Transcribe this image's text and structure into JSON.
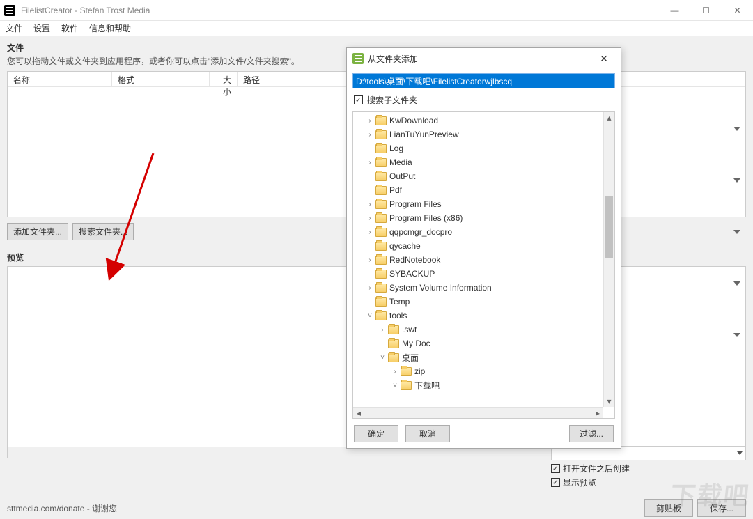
{
  "title": "FilelistCreator - Stefan Trost Media",
  "menu": {
    "file": "文件",
    "settings": "设置",
    "software": "软件",
    "help": "信息和帮助"
  },
  "files_panel": {
    "heading": "文件",
    "hint": "您可以拖动文件或文件夹到应用程序，或者你可以点击\"添加文件/文件夹搜索\"。",
    "cols": {
      "name": "名称",
      "format": "格式",
      "size": "大小",
      "path": "路径"
    },
    "btn_add": "添加文件夹...",
    "btn_search": "搜索文件夹..."
  },
  "preview": {
    "heading": "预览"
  },
  "bottom": {
    "chk_open_after": "打开文件之后创建",
    "chk_show_preview": "显示预览",
    "btn_clipboard": "剪贴板",
    "btn_save": "保存..."
  },
  "status": "sttmedia.com/donate - 谢谢您",
  "dialog": {
    "title": "从文件夹添加",
    "path": "D:\\tools\\桌面\\下载吧\\FilelistCreatorwjlbscq",
    "chk_sub": "搜索子文件夹",
    "btn_ok": "确定",
    "btn_cancel": "取消",
    "btn_filter": "过滤...",
    "tree": [
      {
        "depth": 0,
        "exp": ">",
        "label": "KwDownload"
      },
      {
        "depth": 0,
        "exp": ">",
        "label": "LianTuYunPreview"
      },
      {
        "depth": 0,
        "exp": "",
        "label": "Log"
      },
      {
        "depth": 0,
        "exp": ">",
        "label": "Media"
      },
      {
        "depth": 0,
        "exp": "",
        "label": "OutPut"
      },
      {
        "depth": 0,
        "exp": "",
        "label": "Pdf"
      },
      {
        "depth": 0,
        "exp": ">",
        "label": "Program Files"
      },
      {
        "depth": 0,
        "exp": ">",
        "label": "Program Files (x86)"
      },
      {
        "depth": 0,
        "exp": ">",
        "label": "qqpcmgr_docpro"
      },
      {
        "depth": 0,
        "exp": "",
        "label": "qycache"
      },
      {
        "depth": 0,
        "exp": ">",
        "label": "RedNotebook"
      },
      {
        "depth": 0,
        "exp": "",
        "label": "SYBACKUP"
      },
      {
        "depth": 0,
        "exp": ">",
        "label": "System Volume Information"
      },
      {
        "depth": 0,
        "exp": "",
        "label": "Temp"
      },
      {
        "depth": 0,
        "exp": "v",
        "label": "tools"
      },
      {
        "depth": 1,
        "exp": ">",
        "label": ".swt"
      },
      {
        "depth": 1,
        "exp": "",
        "label": "My Doc"
      },
      {
        "depth": 1,
        "exp": "v",
        "label": "桌面"
      },
      {
        "depth": 2,
        "exp": ">",
        "label": "zip"
      },
      {
        "depth": 2,
        "exp": "v",
        "label": "下载吧"
      }
    ]
  }
}
